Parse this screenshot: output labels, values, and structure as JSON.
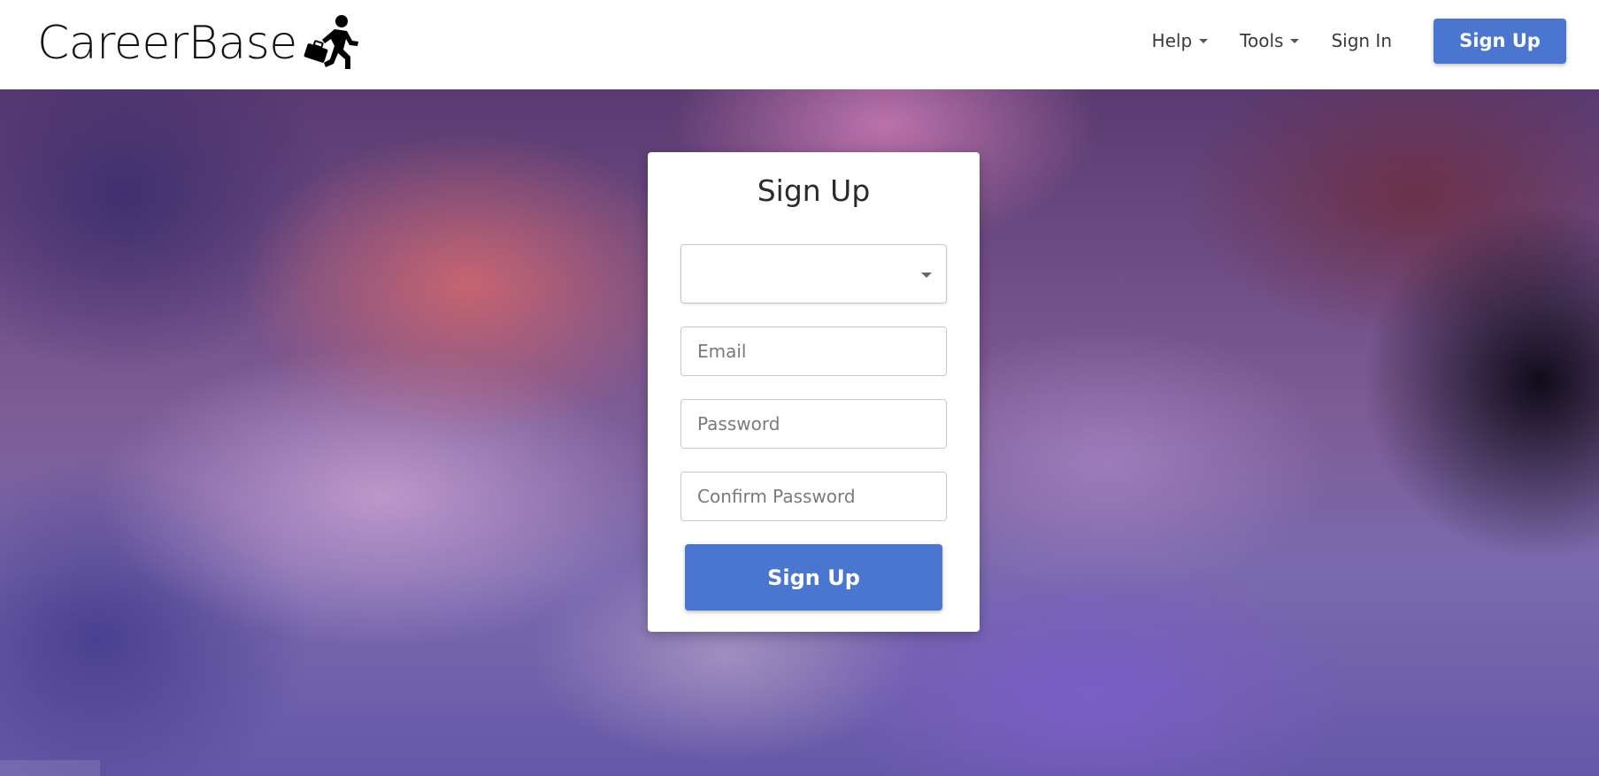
{
  "brand": {
    "name": "CareerBase",
    "icon": "running-businessman-icon"
  },
  "nav": {
    "help_label": "Help",
    "tools_label": "Tools",
    "signin_label": "Sign In",
    "signup_label": "Sign Up"
  },
  "form": {
    "title": "Sign Up",
    "select_value": "",
    "email_placeholder": "Email",
    "password_placeholder": "Password",
    "confirm_password_placeholder": "Confirm Password",
    "submit_label": "Sign Up"
  },
  "colors": {
    "accent": "#4a76cf",
    "navbar_bg": "#ffffff",
    "card_bg": "#ffffff"
  }
}
